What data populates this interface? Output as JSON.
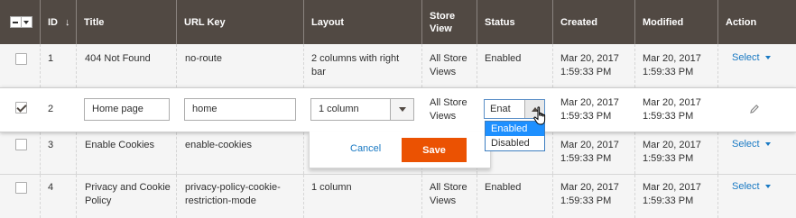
{
  "columns": {
    "id": "ID",
    "sort_indicator": "↓",
    "title": "Title",
    "url_key": "URL Key",
    "layout": "Layout",
    "store_view_line1": "Store",
    "store_view_line2": "View",
    "status": "Status",
    "created": "Created",
    "modified": "Modified",
    "action": "Action"
  },
  "rows": [
    {
      "id": "1",
      "title": "404 Not Found",
      "url_key": "no-route",
      "layout_line1": "2 columns with right",
      "layout_line2": "bar",
      "store_line1": "All Store",
      "store_line2": "Views",
      "status": "Enabled",
      "created_line1": "Mar 20, 2017",
      "created_line2": "1:59:33 PM",
      "modified_line1": "Mar 20, 2017",
      "modified_line2": "1:59:33 PM",
      "action": "Select"
    },
    {
      "id": "2",
      "title": "Home page",
      "url_key": "home",
      "layout": "1 column",
      "store_line1": "All Store",
      "store_line2": "Views",
      "status": "Enat",
      "created_line1": "Mar 20, 2017",
      "created_line2": "1:59:33 PM",
      "modified_line1": "Mar 20, 2017",
      "modified_line2": "1:59:33 PM"
    },
    {
      "id": "3",
      "title": "Enable Cookies",
      "url_key": "enable-cookies",
      "created_line1": "Mar 20, 2017",
      "created_line2": "1:59:33 PM",
      "modified_line1": "Mar 20, 2017",
      "modified_line2": "1:59:33 PM",
      "action": "Select"
    },
    {
      "id": "4",
      "title_line1": "Privacy and Cookie",
      "title_line2": "Policy",
      "url_line1": "privacy-policy-cookie-",
      "url_line2": "restriction-mode",
      "layout": "1 column",
      "store_line1": "All Store",
      "store_line2": "Views",
      "status": "Enabled",
      "created_line1": "Mar 20, 2017",
      "created_line2": "1:59:33 PM",
      "modified_line1": "Mar 20, 2017",
      "modified_line2": "1:59:33 PM",
      "action": "Select"
    }
  ],
  "status_options": [
    "Enabled",
    "Disabled"
  ],
  "edit_actions": {
    "cancel": "Cancel",
    "save": "Save"
  },
  "colors": {
    "header_bg": "#514943",
    "link": "#1979c3",
    "save_bg": "#eb5202",
    "dropdown_selected": "#1e90ff"
  },
  "icons": {
    "edit": "pencil-icon",
    "cursor": "hand-pointer-icon",
    "sort": "arrow-down-icon"
  }
}
